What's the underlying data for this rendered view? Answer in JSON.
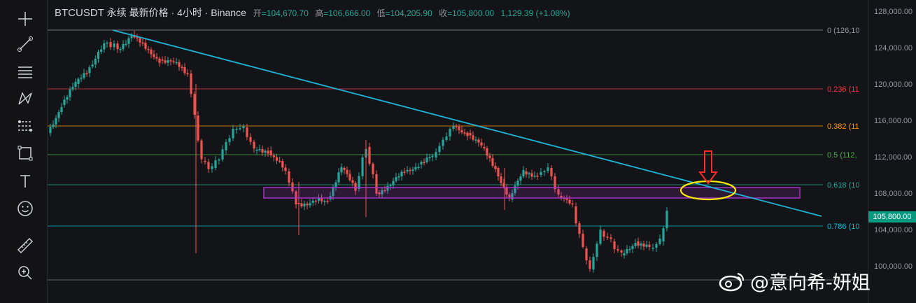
{
  "header": {
    "symbol": "BTCUSDT",
    "meta": " 永续 最新价格 · 4小时 · Binance",
    "open_label": "开",
    "open_value": "=104,670.70",
    "high_label": "高",
    "high_value": "=106,666.00",
    "low_label": "低",
    "low_value": "=104,205.90",
    "close_label": "收",
    "close_value": "=105,800.00",
    "change_value": "1,129.39 (+1.08%)"
  },
  "price_axis": {
    "labels": [
      "128,000.00",
      "124,000.00",
      "120,000.00",
      "116,000.00",
      "112,000.00",
      "108,000.00",
      "104,000.00",
      "100,000.00"
    ],
    "current_price": "105,800.00"
  },
  "fib_levels": [
    {
      "label": "0 (126,10",
      "color": "#9598a1"
    },
    {
      "label": "0.236 (11",
      "color": "#f23645"
    },
    {
      "label": "0.382 (11",
      "color": "#ff9800"
    },
    {
      "label": "0.5 (112,",
      "color": "#4caf50"
    },
    {
      "label": "0.618 (10",
      "color": "#26a69a"
    },
    {
      "label": "0.786 (10",
      "color": "#00bcd4"
    }
  ],
  "colors": {
    "up": "#26a69a",
    "down": "#ef5350",
    "trendline": "#1cb5d9",
    "zone": "#a633c7",
    "ellipse": "#ffeb00",
    "arrow": "#ff2b2b"
  },
  "toolbar": {
    "icons": [
      "crosshair-icon",
      "trendline-icon",
      "fib-icon",
      "pattern-icon",
      "projection-icon",
      "rectangle-icon",
      "text-icon",
      "emoji-icon",
      "ruler-icon",
      "zoom-icon"
    ]
  },
  "watermark": "@意向希-妍姐"
}
